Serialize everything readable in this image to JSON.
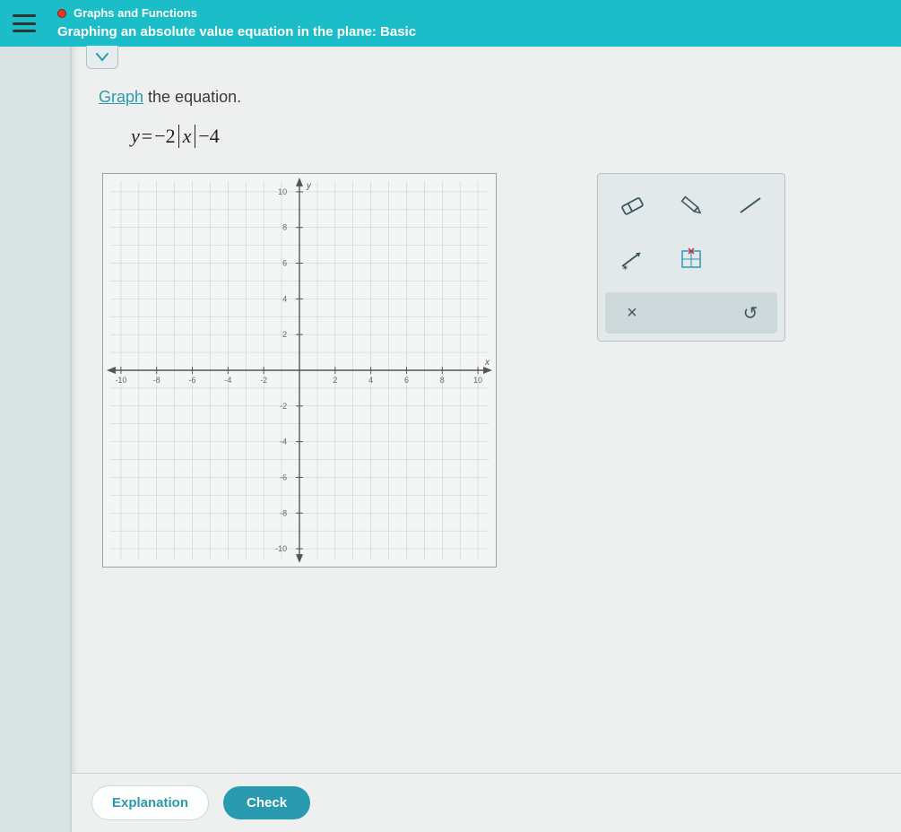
{
  "header": {
    "category": "Graphs and Functions",
    "lesson": "Graphing an absolute value equation in the plane: Basic"
  },
  "prompt": {
    "link_text": "Graph",
    "rest": " the equation."
  },
  "equation": {
    "lhs": "y",
    "eq": "=",
    "coef": "−2",
    "var": "x",
    "tail": "−4"
  },
  "buttons": {
    "explanation": "Explanation",
    "check": "Check"
  },
  "tools": {
    "clear": "×",
    "undo": "↺"
  },
  "chart_data": {
    "type": "line",
    "title": "",
    "xlabel": "x",
    "ylabel": "y",
    "xlim": [
      -11,
      11
    ],
    "ylim": [
      -11,
      11
    ],
    "xticks": [
      -10,
      -8,
      -6,
      -4,
      -2,
      2,
      4,
      6,
      8,
      10
    ],
    "yticks": [
      -10,
      -8,
      -6,
      -4,
      -2,
      2,
      4,
      6,
      8,
      10
    ],
    "series": []
  }
}
